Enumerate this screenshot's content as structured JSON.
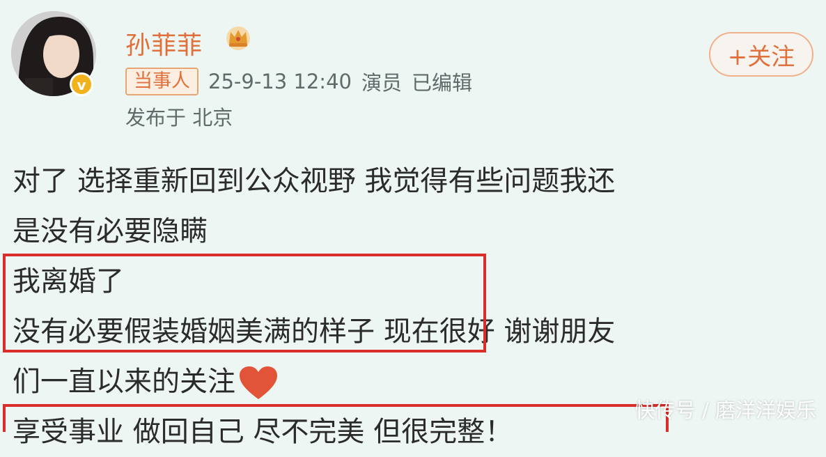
{
  "profile": {
    "username": "孙菲菲",
    "crown_icon": "crown-icon",
    "verified_icon": "verified-badge-icon",
    "verified_mark": "v"
  },
  "follow_button": {
    "label": "+关注",
    "color": "#e0713d"
  },
  "meta": {
    "tag": "当事人",
    "timestamp": "25-9-13 12:40",
    "role": "演员",
    "edited": "已编辑",
    "location": "发布于 北京"
  },
  "post": {
    "lines": [
      "对了 选择重新回到公众视野 我觉得有些问题我还",
      "是没有必要隐瞒",
      "我离婚了",
      "没有必要假装婚姻美满的样子 现在很好 谢谢朋友",
      "们一直以来的关注",
      "享受事业 做回自己 尽不完美 但很完整！"
    ],
    "heart_icon": "heart-icon",
    "heart_color": "#e2543a"
  },
  "highlight_color": "#d92d2a",
  "watermark": "快传号 / 磨洋洋娱乐"
}
